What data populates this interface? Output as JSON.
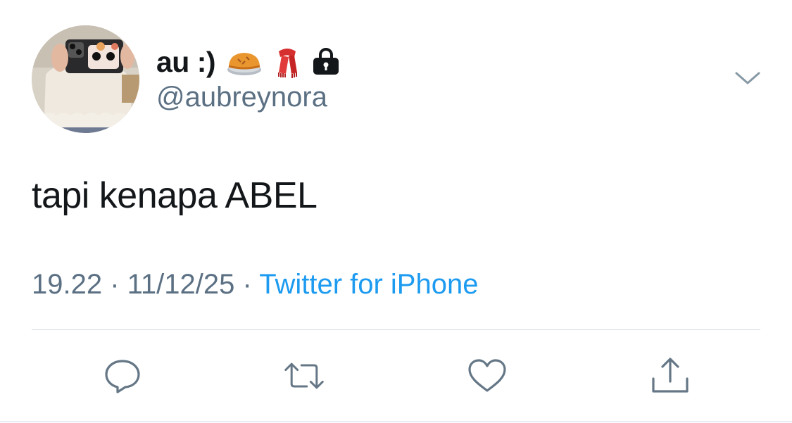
{
  "user": {
    "display_name": "au :)",
    "name_emojis": [
      "pie-icon",
      "scarf-icon",
      "locked-account-icon"
    ],
    "handle": "@aubreynora",
    "avatar": "profile-photo"
  },
  "tweet": {
    "text": "tapi kenapa ABEL",
    "time": "19.22",
    "separator1": " · ",
    "date": "11/12/25",
    "separator2": " · ",
    "source": "Twitter for iPhone"
  },
  "actions": [
    "reply-icon",
    "retweet-icon",
    "like-icon",
    "share-icon"
  ],
  "colors": {
    "text": "#14171a",
    "secondary": "#5b7083",
    "link": "#1d9bf0",
    "icon": "#657786"
  }
}
